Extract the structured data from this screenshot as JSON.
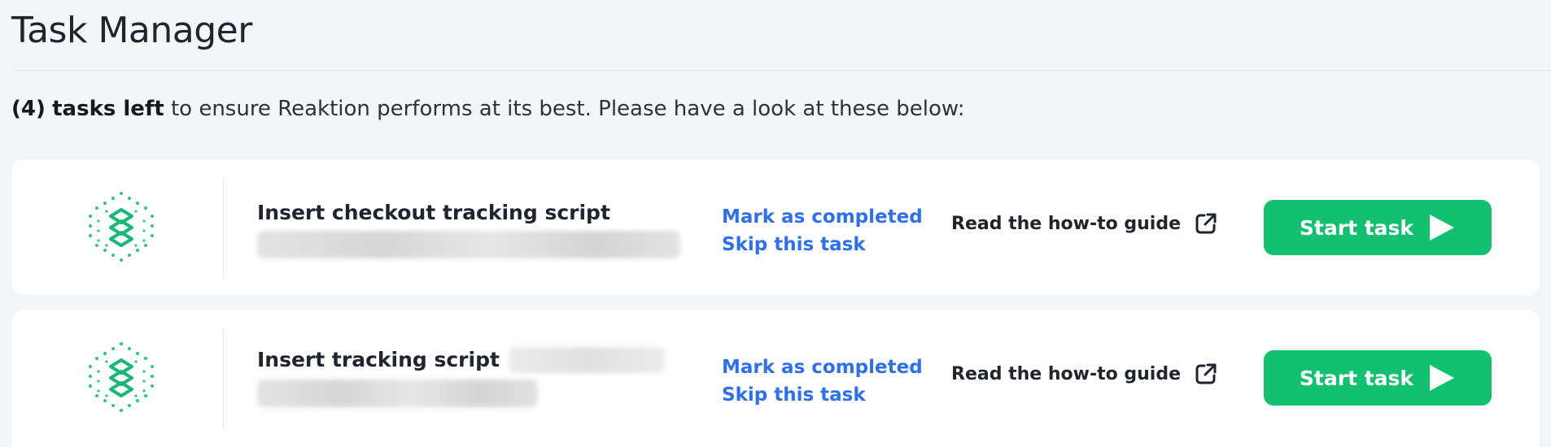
{
  "header": {
    "title": "Task Manager"
  },
  "summary": {
    "count": "(4)",
    "strong": "tasks left",
    "rest": "to ensure Reaktion performs at its best. Please have a look at these below:"
  },
  "tasks": [
    {
      "title": "Insert checkout tracking script",
      "mark_completed": "Mark as completed",
      "skip": "Skip this task",
      "guide": "Read the how-to guide",
      "start": "Start task"
    },
    {
      "title": "Insert tracking script",
      "mark_completed": "Mark as completed",
      "skip": "Skip this task",
      "guide": "Read the how-to guide",
      "start": "Start task"
    }
  ],
  "icons": {
    "task_logo": "reaktion-hexagon-logo-icon",
    "external_link": "external-link-icon",
    "play": "play-icon"
  },
  "colors": {
    "accent_green": "#12c070",
    "link_blue": "#2f6fe8",
    "page_bg": "#f3f6f9",
    "card_bg": "#ffffff"
  }
}
